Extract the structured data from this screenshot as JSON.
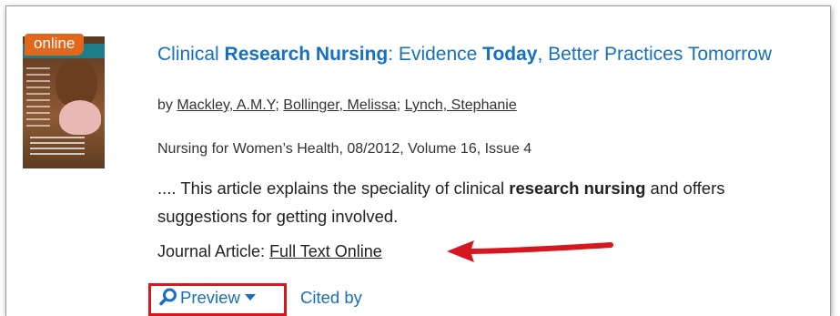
{
  "badge": {
    "label": "online"
  },
  "result": {
    "title_parts": [
      {
        "text": "Clinical ",
        "bold": false
      },
      {
        "text": "Research Nursing",
        "bold": true
      },
      {
        "text": ": Evidence ",
        "bold": false
      },
      {
        "text": "Today",
        "bold": true
      },
      {
        "text": ", Better Practices Tomorrow",
        "bold": false
      }
    ],
    "by_label": "by ",
    "authors": [
      "Mackley, A.M.Y",
      "Bollinger, Melissa",
      "Lynch, Stephanie"
    ],
    "source": "Nursing for Women’s Health, 08/2012, Volume 16, Issue 4",
    "snippet_parts": [
      {
        "text": ".... This article explains the speciality of clinical ",
        "bold": false
      },
      {
        "text": "research nursing",
        "bold": true
      },
      {
        "text": " and offers suggestions for getting involved.",
        "bold": false
      }
    ],
    "type_label": "Journal Article: ",
    "availability_link": "Full Text Online"
  },
  "actions": {
    "preview_label": "Preview",
    "cited_label": "Cited by"
  },
  "colors": {
    "link": "#1570c2",
    "badge": "#e4661b",
    "highlight": "#d6171f"
  },
  "icons": {
    "preview": "magnifier-icon",
    "dropdown": "caret-down-icon",
    "annotation": "red-arrow-icon"
  }
}
